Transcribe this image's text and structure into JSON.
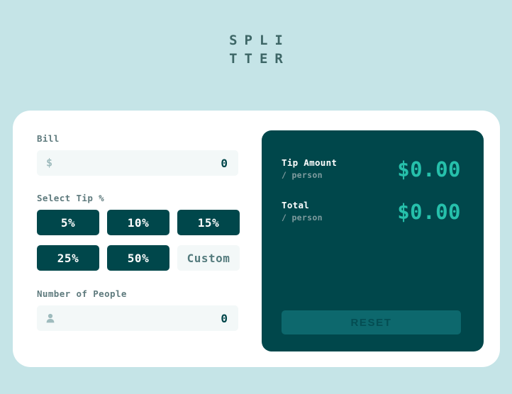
{
  "app": {
    "logo_line_1": "SPLI",
    "logo_line_2": "TTER"
  },
  "bill": {
    "label": "Bill",
    "icon": "dollar-icon",
    "value": "0",
    "placeholder": "0"
  },
  "tip": {
    "label": "Select Tip %",
    "options": [
      {
        "label": "5%",
        "selected": false
      },
      {
        "label": "10%",
        "selected": false
      },
      {
        "label": "15%",
        "selected": false
      },
      {
        "label": "25%",
        "selected": false
      },
      {
        "label": "50%",
        "selected": false
      }
    ],
    "custom_label": "Custom",
    "custom_placeholder": "Custom"
  },
  "people": {
    "label": "Number of People",
    "icon": "person-icon",
    "value": "0",
    "placeholder": "0"
  },
  "results": {
    "tip_amount": {
      "title": "Tip Amount",
      "subtitle": "/ person",
      "amount": "$0.00"
    },
    "total": {
      "title": "Total",
      "subtitle": "/ person",
      "amount": "$0.00"
    },
    "reset_label": "RESET"
  },
  "colors": {
    "background": "#c5e4e7",
    "card": "#ffffff",
    "dark_teal": "#00474b",
    "panel_accent": "#26c0ab",
    "input_bg": "#f3f8f8",
    "label_text": "#5e7a7d",
    "reset_bg": "#0d686d"
  }
}
